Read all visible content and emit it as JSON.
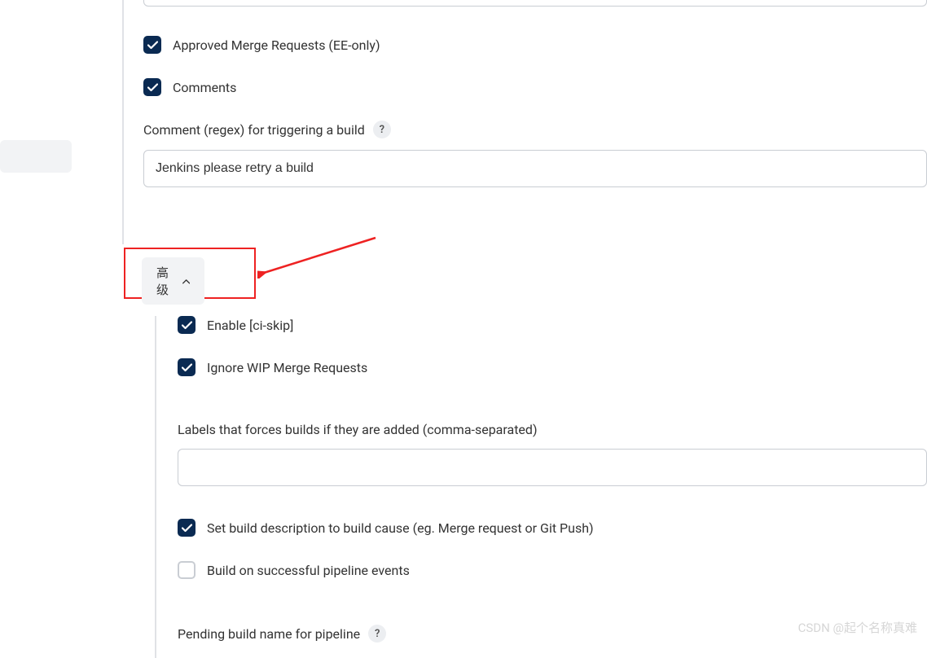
{
  "options": {
    "approved_mr": {
      "label": "Approved Merge Requests (EE-only)",
      "checked": true
    },
    "comments": {
      "label": "Comments",
      "checked": true
    }
  },
  "comment_regex": {
    "label": "Comment (regex) for triggering a build",
    "help": "?",
    "value": "Jenkins please retry a build"
  },
  "advanced": {
    "btn_label": "高级",
    "enable_ci_skip": {
      "label": "Enable [ci-skip]",
      "checked": true
    },
    "ignore_wip": {
      "label": "Ignore WIP Merge Requests",
      "checked": true
    },
    "labels_force": {
      "label": "Labels that forces builds if they are added (comma-separated)",
      "value": ""
    },
    "set_desc": {
      "label": "Set build description to build cause (eg. Merge request or Git Push)",
      "checked": true
    },
    "build_on_pipeline": {
      "label": "Build on successful pipeline events",
      "checked": false
    },
    "pending_name": {
      "label": "Pending build name for pipeline",
      "help": "?"
    }
  },
  "watermark": "CSDN @起个名称真难"
}
